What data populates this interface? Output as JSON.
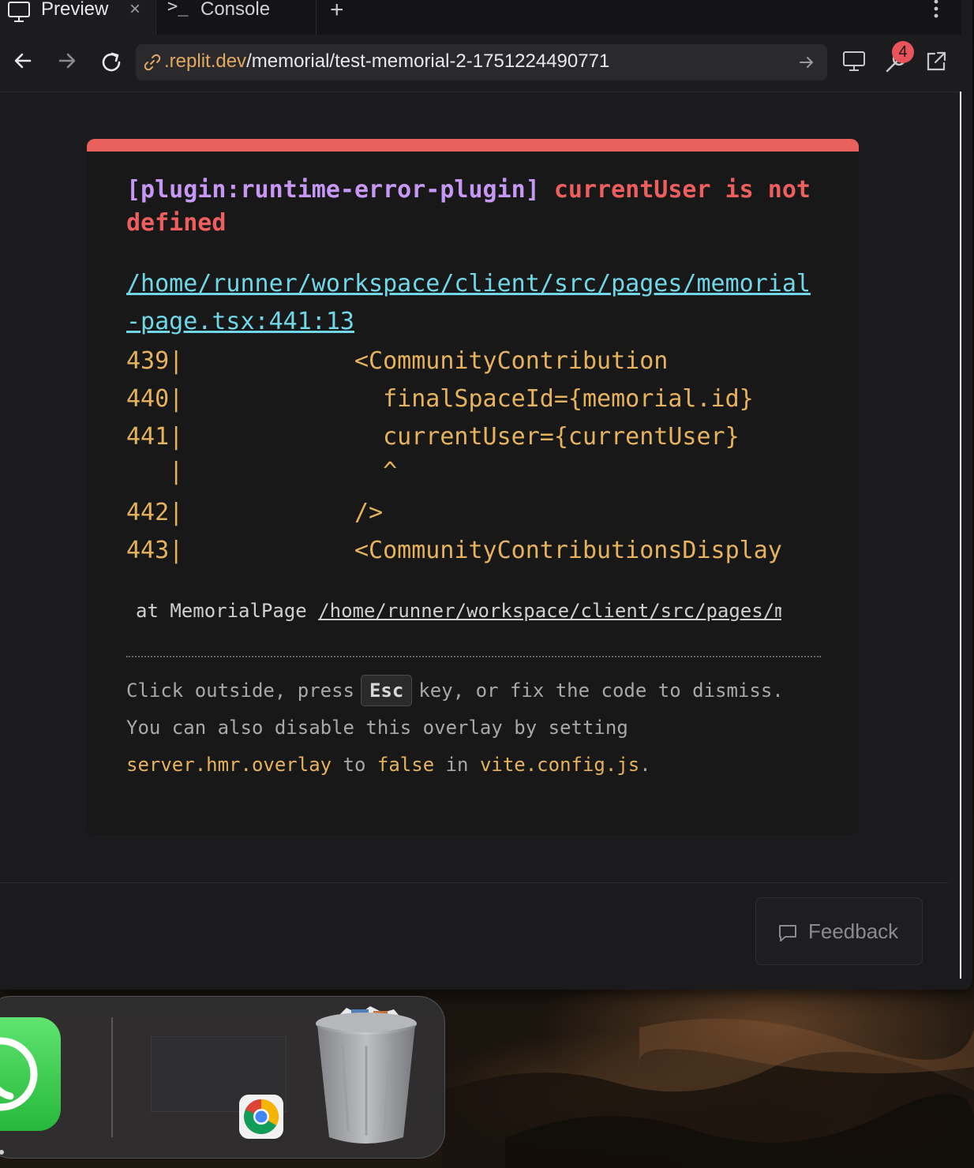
{
  "tabs": [
    {
      "label": "Preview",
      "icon": "monitor-icon",
      "active": true
    },
    {
      "label": "Console",
      "icon": "terminal-icon",
      "active": false
    }
  ],
  "tab_close_glyph": "×",
  "new_tab_glyph": "+",
  "url": {
    "domain": ".replit.dev",
    "path": "/memorial/test-memorial-2-1751224490771"
  },
  "devtools_badge": "4",
  "error": {
    "plugin": "[plugin:runtime-error-plugin]",
    "message": "currentUser is not defined",
    "file": "/home/runner/workspace/client/src/pages/memorial-page.tsx:441:13",
    "code_lines": [
      "439|            <CommunityContribution",
      "440|              finalSpaceId={memorial.id}",
      "441|              currentUser={currentUser}",
      "   |              ^",
      "442|            />",
      "443|            <CommunityContributionsDisplay"
    ],
    "stack_prefix": "at MemorialPage ",
    "stack_path": "/home/runner/workspace/client/src/pages/memorial-page.tsx",
    "tip_line1_before": "Click outside, press",
    "tip_key": "Esc",
    "tip_line1_after": "key, or fix the code to dismiss.",
    "tip_line2_a": "You can also disable this overlay by setting",
    "tip_code1": "server.hmr.overlay",
    "tip_line2_b": " to ",
    "tip_code2": "false",
    "tip_line2_c": " in ",
    "tip_code3": "vite.config.js",
    "tip_line2_d": "."
  },
  "feedback_label": "Feedback",
  "colors": {
    "accent_error": "#e8615c",
    "plugin": "#c797f6",
    "link": "#6fd7e8",
    "code": "#e6b25c",
    "domain": "#e2a862"
  },
  "dock": {
    "apps": [
      "whatsapp-icon",
      "chrome-icon",
      "trash-icon"
    ]
  }
}
